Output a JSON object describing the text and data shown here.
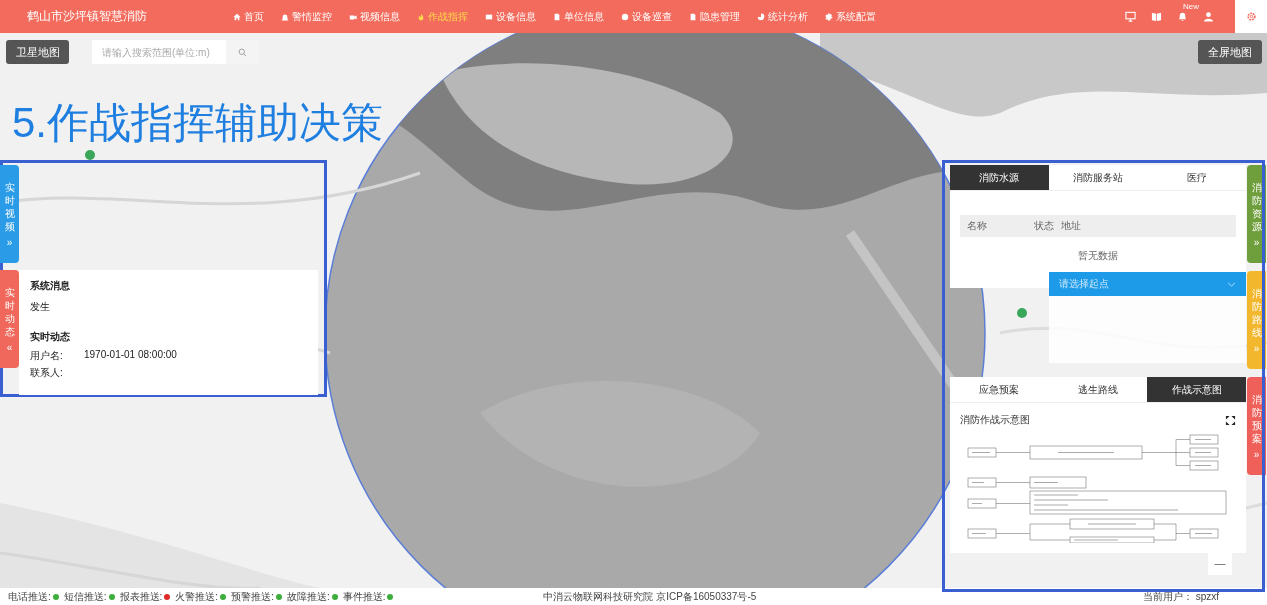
{
  "header": {
    "title": "鹤山市沙坪镇智慧消防",
    "new_badge": "New",
    "nav": [
      {
        "label": "首页",
        "selected": false
      },
      {
        "label": "警情监控",
        "selected": false
      },
      {
        "label": "视频信息",
        "selected": false
      },
      {
        "label": "作战指挥",
        "selected": true
      },
      {
        "label": "设备信息",
        "selected": false
      },
      {
        "label": "单位信息",
        "selected": false
      },
      {
        "label": "设备巡查",
        "selected": false
      },
      {
        "label": "隐患管理",
        "selected": false
      },
      {
        "label": "统计分析",
        "selected": false
      },
      {
        "label": "系统配置",
        "selected": false
      }
    ]
  },
  "map_controls": {
    "satellite_button": "卫星地图",
    "search": {
      "placeholder": "请输入搜索范围(单位:m)"
    },
    "fullscreen_button": "全屏地图",
    "zoom_out": "—"
  },
  "annotation_title": "5.作战指挥辅助决策",
  "left_panel": {
    "side_tabs": [
      {
        "label": "实时视频",
        "arrow": "»",
        "color": "#2a9be6"
      },
      {
        "label": "实时动态",
        "arrow": "«",
        "color": "#f0685c"
      }
    ],
    "system_message": {
      "heading": "系统消息",
      "text": "发生"
    },
    "live_updates": {
      "heading": "实时动态",
      "rows": [
        {
          "label": "用户名:",
          "value": "1970-01-01 08:00:00"
        },
        {
          "label": "联系人:",
          "value": ""
        }
      ]
    }
  },
  "right_panel": {
    "resource_tabs": [
      {
        "label": "消防水源",
        "selected": true
      },
      {
        "label": "消防服务站",
        "selected": false
      },
      {
        "label": "医疗",
        "selected": false
      }
    ],
    "table": {
      "columns": [
        "名称",
        "状态",
        "地址"
      ],
      "empty_text": "暂无数据"
    },
    "route_select": {
      "placeholder": "请选择起点"
    },
    "side_tabs": [
      {
        "label": "消防资源",
        "arrow": "»",
        "color": "#6f9e3c"
      },
      {
        "label": "消防路线",
        "arrow": "»",
        "color": "#f2b72c"
      },
      {
        "label": "消防预案",
        "arrow": "»",
        "color": "#f0605a"
      }
    ],
    "plan_tabs": [
      {
        "label": "应急预案",
        "selected": false
      },
      {
        "label": "逃生路线",
        "selected": false
      },
      {
        "label": "作战示意图",
        "selected": true
      }
    ],
    "diagram_title": "消防作战示意图"
  },
  "status_bar": {
    "pushes": [
      {
        "label": "电话推送:",
        "color": "#3cae3c"
      },
      {
        "label": "短信推送:",
        "color": "#3cae3c"
      },
      {
        "label": "报表推送:",
        "color": "#e02a2a"
      },
      {
        "label": "火警推送:",
        "color": "#3cae3c"
      },
      {
        "label": "预警推送:",
        "color": "#3cae3c"
      },
      {
        "label": "故障推送:",
        "color": "#3cae3c"
      },
      {
        "label": "事件推送:",
        "color": "#3cae3c"
      }
    ],
    "copyright": "中消云物联网科技研究院 京ICP备16050337号-5",
    "current_user": "当前用户： spzxf"
  }
}
